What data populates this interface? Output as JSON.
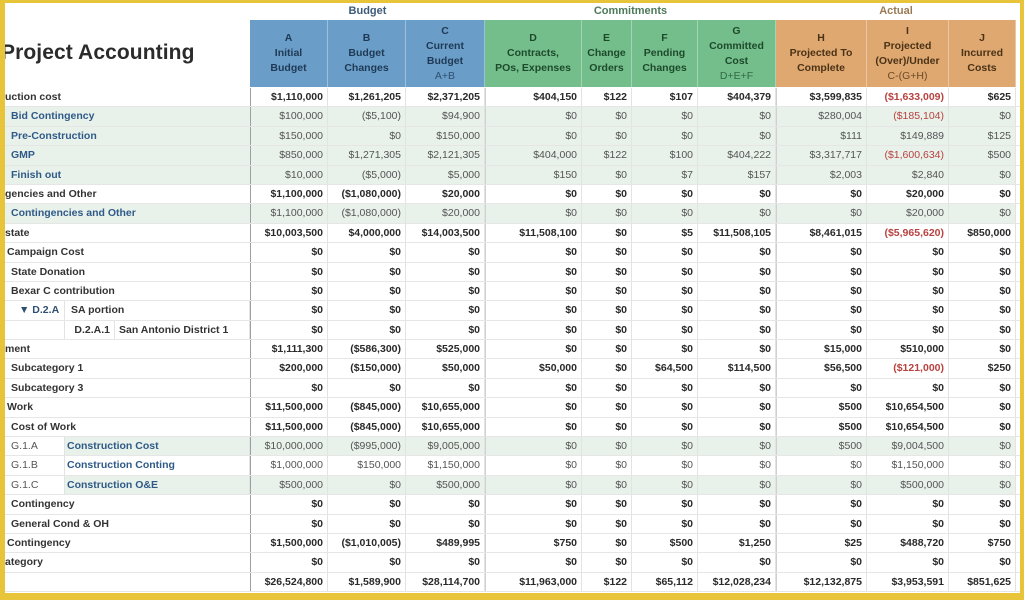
{
  "app": {
    "title": "Project Accounting"
  },
  "groups": [
    {
      "label": "Budget"
    },
    {
      "label": "Commitments"
    },
    {
      "label": "Actual"
    }
  ],
  "columns": [
    {
      "letter": "A",
      "title": "Initial\nBudget",
      "formula": ""
    },
    {
      "letter": "B",
      "title": "Budget\nChanges",
      "formula": ""
    },
    {
      "letter": "C",
      "title": "Current\nBudget",
      "formula": "A+B"
    },
    {
      "letter": "D",
      "title": "Contracts,\nPOs, Expenses",
      "formula": ""
    },
    {
      "letter": "E",
      "title": "Change\nOrders",
      "formula": ""
    },
    {
      "letter": "F",
      "title": "Pending\nChanges",
      "formula": ""
    },
    {
      "letter": "G",
      "title": "Committed\nCost",
      "formula": "D+E+F"
    },
    {
      "letter": "H",
      "title": "Projected To\nComplete",
      "formula": ""
    },
    {
      "letter": "I",
      "title": "Projected\n(Over)/Under",
      "formula": "C-(G+H)"
    },
    {
      "letter": "J",
      "title": "Incurred\nCosts",
      "formula": ""
    }
  ],
  "colors": {
    "budget": "#6a9ec9",
    "commitments": "#74be8b",
    "actual": "#dfa870",
    "negative": "#b8423f",
    "frame": "#e8c43a"
  },
  "rows": [
    {
      "code": "",
      "label": "uction cost",
      "style": "section",
      "values": [
        "$1,110,000",
        "$1,261,205",
        "$2,371,205",
        "$404,150",
        "$122",
        "$107",
        "$404,379",
        "$3,599,835",
        "($1,633,009)",
        "$625"
      ],
      "neg": [
        8
      ]
    },
    {
      "code": "",
      "label": "Bid Contingency",
      "style": "blue",
      "values": [
        "$100,000",
        "($5,100)",
        "$94,900",
        "$0",
        "$0",
        "$0",
        "$0",
        "$280,004",
        "($185,104)",
        "$0"
      ],
      "neg": [
        8
      ]
    },
    {
      "code": "",
      "label": "Pre-Construction",
      "style": "blue",
      "values": [
        "$150,000",
        "$0",
        "$150,000",
        "$0",
        "$0",
        "$0",
        "$0",
        "$111",
        "$149,889",
        "$125"
      ],
      "neg": []
    },
    {
      "code": "",
      "label": "GMP",
      "style": "blue",
      "values": [
        "$850,000",
        "$1,271,305",
        "$2,121,305",
        "$404,000",
        "$122",
        "$100",
        "$404,222",
        "$3,317,717",
        "($1,600,634)",
        "$500"
      ],
      "neg": [
        8
      ]
    },
    {
      "code": "",
      "label": "Finish out",
      "style": "blue",
      "values": [
        "$10,000",
        "($5,000)",
        "$5,000",
        "$150",
        "$0",
        "$7",
        "$157",
        "$2,003",
        "$2,840",
        "$0"
      ],
      "neg": []
    },
    {
      "code": "",
      "label": "gencies and Other",
      "style": "section",
      "values": [
        "$1,100,000",
        "($1,080,000)",
        "$20,000",
        "$0",
        "$0",
        "$0",
        "$0",
        "$0",
        "$20,000",
        "$0"
      ],
      "neg": []
    },
    {
      "code": "",
      "label": "Contingencies and Other",
      "style": "blue",
      "values": [
        "$1,100,000",
        "($1,080,000)",
        "$20,000",
        "$0",
        "$0",
        "$0",
        "$0",
        "$0",
        "$20,000",
        "$0"
      ],
      "neg": []
    },
    {
      "code": "",
      "label": "state",
      "style": "section",
      "values": [
        "$10,003,500",
        "$4,000,000",
        "$14,003,500",
        "$11,508,100",
        "$0",
        "$5",
        "$11,508,105",
        "$8,461,015",
        "($5,965,620)",
        "$850,000"
      ],
      "neg": [
        8
      ]
    },
    {
      "code": "",
      "label": "Campaign Cost",
      "style": "item1",
      "values": [
        "$0",
        "$0",
        "$0",
        "$0",
        "$0",
        "$0",
        "$0",
        "$0",
        "$0",
        "$0"
      ],
      "neg": []
    },
    {
      "code": "",
      "label": "State Donation",
      "style": "item2",
      "values": [
        "$0",
        "$0",
        "$0",
        "$0",
        "$0",
        "$0",
        "$0",
        "$0",
        "$0",
        "$0"
      ],
      "neg": []
    },
    {
      "code": "",
      "label": "Bexar C contribution",
      "style": "item2",
      "values": [
        "$0",
        "$0",
        "$0",
        "$0",
        "$0",
        "$0",
        "$0",
        "$0",
        "$0",
        "$0"
      ],
      "neg": []
    },
    {
      "code": "▼ D.2.A",
      "label": "SA portion",
      "style": "sub-a",
      "values": [
        "$0",
        "$0",
        "$0",
        "$0",
        "$0",
        "$0",
        "$0",
        "$0",
        "$0",
        "$0"
      ],
      "neg": []
    },
    {
      "code": "D.2.A.1",
      "label": "San Antonio District 1",
      "style": "sub-b",
      "values": [
        "$0",
        "$0",
        "$0",
        "$0",
        "$0",
        "$0",
        "$0",
        "$0",
        "$0",
        "$0"
      ],
      "neg": []
    },
    {
      "code": "",
      "label": "ment",
      "style": "section",
      "values": [
        "$1,111,300",
        "($586,300)",
        "$525,000",
        "$0",
        "$0",
        "$0",
        "$0",
        "$15,000",
        "$510,000",
        "$0"
      ],
      "neg": []
    },
    {
      "code": "",
      "label": "Subcategory 1",
      "style": "item2",
      "values": [
        "$200,000",
        "($150,000)",
        "$50,000",
        "$50,000",
        "$0",
        "$64,500",
        "$114,500",
        "$56,500",
        "($121,000)",
        "$250"
      ],
      "neg": [
        8
      ]
    },
    {
      "code": "",
      "label": "Subcategory 3",
      "style": "item2",
      "values": [
        "$0",
        "$0",
        "$0",
        "$0",
        "$0",
        "$0",
        "$0",
        "$0",
        "$0",
        "$0"
      ],
      "neg": []
    },
    {
      "code": "",
      "label": "Work",
      "style": "item1",
      "values": [
        "$11,500,000",
        "($845,000)",
        "$10,655,000",
        "$0",
        "$0",
        "$0",
        "$0",
        "$500",
        "$10,654,500",
        "$0"
      ],
      "neg": []
    },
    {
      "code": "",
      "label": "Cost of Work",
      "style": "item2",
      "values": [
        "$11,500,000",
        "($845,000)",
        "$10,655,000",
        "$0",
        "$0",
        "$0",
        "$0",
        "$500",
        "$10,654,500",
        "$0"
      ],
      "neg": []
    },
    {
      "code": "G.1.A",
      "label": "Construction Cost",
      "style": "leaf-shaded",
      "values": [
        "$10,000,000",
        "($995,000)",
        "$9,005,000",
        "$0",
        "$0",
        "$0",
        "$0",
        "$500",
        "$9,004,500",
        "$0"
      ],
      "neg": []
    },
    {
      "code": "G.1.B",
      "label": "Construction Conting",
      "style": "leaf",
      "values": [
        "$1,000,000",
        "$150,000",
        "$1,150,000",
        "$0",
        "$0",
        "$0",
        "$0",
        "$0",
        "$1,150,000",
        "$0"
      ],
      "neg": []
    },
    {
      "code": "G.1.C",
      "label": "Construction O&E",
      "style": "leaf-shaded",
      "values": [
        "$500,000",
        "$0",
        "$500,000",
        "$0",
        "$0",
        "$0",
        "$0",
        "$0",
        "$500,000",
        "$0"
      ],
      "neg": []
    },
    {
      "code": "",
      "label": "Contingency",
      "style": "item2",
      "values": [
        "$0",
        "$0",
        "$0",
        "$0",
        "$0",
        "$0",
        "$0",
        "$0",
        "$0",
        "$0"
      ],
      "neg": []
    },
    {
      "code": "",
      "label": "General Cond & OH",
      "style": "item2",
      "values": [
        "$0",
        "$0",
        "$0",
        "$0",
        "$0",
        "$0",
        "$0",
        "$0",
        "$0",
        "$0"
      ],
      "neg": []
    },
    {
      "code": "",
      "label": "Contingency",
      "style": "item1",
      "values": [
        "$1,500,000",
        "($1,010,005)",
        "$489,995",
        "$750",
        "$0",
        "$500",
        "$1,250",
        "$25",
        "$488,720",
        "$750"
      ],
      "neg": []
    },
    {
      "code": "",
      "label": "ategory",
      "style": "section",
      "values": [
        "$0",
        "$0",
        "$0",
        "$0",
        "$0",
        "$0",
        "$0",
        "$0",
        "$0",
        "$0"
      ],
      "neg": []
    },
    {
      "code": "",
      "label": "",
      "style": "total",
      "values": [
        "$26,524,800",
        "$1,589,900",
        "$28,114,700",
        "$11,963,000",
        "$122",
        "$65,112",
        "$12,028,234",
        "$12,132,875",
        "$3,953,591",
        "$851,625"
      ],
      "neg": []
    }
  ]
}
